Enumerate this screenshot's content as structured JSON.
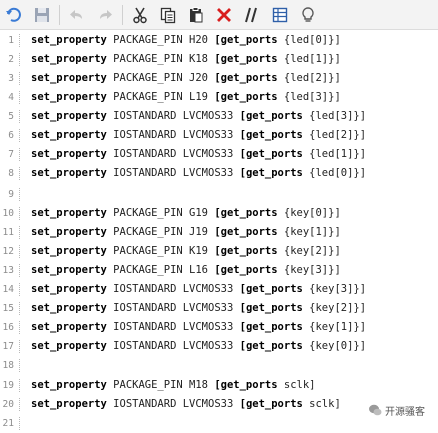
{
  "toolbar": {
    "icons": [
      "undo-icon",
      "save-icon",
      "undo-arrow-icon",
      "redo-arrow-icon",
      "cut-icon",
      "copy-icon",
      "paste-icon",
      "delete-icon",
      "comment-icon",
      "table-icon",
      "lightbulb-icon"
    ]
  },
  "editor": {
    "lines": [
      {
        "num": "1",
        "kw": "set_property",
        "rest": " PACKAGE_PIN H20 ",
        "kw2": "[get_ports",
        "tail": " {led[0]}]"
      },
      {
        "num": "2",
        "kw": "set_property",
        "rest": " PACKAGE_PIN K18 ",
        "kw2": "[get_ports",
        "tail": " {led[1]}]"
      },
      {
        "num": "3",
        "kw": "set_property",
        "rest": " PACKAGE_PIN J20 ",
        "kw2": "[get_ports",
        "tail": " {led[2]}]"
      },
      {
        "num": "4",
        "kw": "set_property",
        "rest": " PACKAGE_PIN L19 ",
        "kw2": "[get_ports",
        "tail": " {led[3]}]"
      },
      {
        "num": "5",
        "kw": "set_property",
        "rest": " IOSTANDARD LVCMOS33 ",
        "kw2": "[get_ports",
        "tail": " {led[3]}]"
      },
      {
        "num": "6",
        "kw": "set_property",
        "rest": " IOSTANDARD LVCMOS33 ",
        "kw2": "[get_ports",
        "tail": " {led[2]}]"
      },
      {
        "num": "7",
        "kw": "set_property",
        "rest": " IOSTANDARD LVCMOS33 ",
        "kw2": "[get_ports",
        "tail": " {led[1]}]"
      },
      {
        "num": "8",
        "kw": "set_property",
        "rest": " IOSTANDARD LVCMOS33 ",
        "kw2": "[get_ports",
        "tail": " {led[0]}]"
      },
      {
        "num": "9",
        "kw": "",
        "rest": "",
        "kw2": "",
        "tail": ""
      },
      {
        "num": "10",
        "kw": "set_property",
        "rest": " PACKAGE_PIN G19 ",
        "kw2": "[get_ports",
        "tail": " {key[0]}]"
      },
      {
        "num": "11",
        "kw": "set_property",
        "rest": " PACKAGE_PIN J19 ",
        "kw2": "[get_ports",
        "tail": " {key[1]}]"
      },
      {
        "num": "12",
        "kw": "set_property",
        "rest": " PACKAGE_PIN K19 ",
        "kw2": "[get_ports",
        "tail": " {key[2]}]"
      },
      {
        "num": "13",
        "kw": "set_property",
        "rest": " PACKAGE_PIN L16 ",
        "kw2": "[get_ports",
        "tail": " {key[3]}]"
      },
      {
        "num": "14",
        "kw": "set_property",
        "rest": " IOSTANDARD LVCMOS33 ",
        "kw2": "[get_ports",
        "tail": " {key[3]}]"
      },
      {
        "num": "15",
        "kw": "set_property",
        "rest": " IOSTANDARD LVCMOS33 ",
        "kw2": "[get_ports",
        "tail": " {key[2]}]"
      },
      {
        "num": "16",
        "kw": "set_property",
        "rest": " IOSTANDARD LVCMOS33 ",
        "kw2": "[get_ports",
        "tail": " {key[1]}]"
      },
      {
        "num": "17",
        "kw": "set_property",
        "rest": " IOSTANDARD LVCMOS33 ",
        "kw2": "[get_ports",
        "tail": " {key[0]}]"
      },
      {
        "num": "18",
        "kw": "",
        "rest": "",
        "kw2": "",
        "tail": ""
      },
      {
        "num": "19",
        "kw": "set_property",
        "rest": " PACKAGE_PIN M18 ",
        "kw2": "[get_ports",
        "tail": " sclk]"
      },
      {
        "num": "20",
        "kw": "set_property",
        "rest": " IOSTANDARD LVCMOS33 ",
        "kw2": "[get_ports",
        "tail": " sclk]"
      },
      {
        "num": "21",
        "kw": "",
        "rest": "",
        "kw2": "",
        "tail": ""
      }
    ]
  },
  "watermark": {
    "text": "开源骚客"
  }
}
